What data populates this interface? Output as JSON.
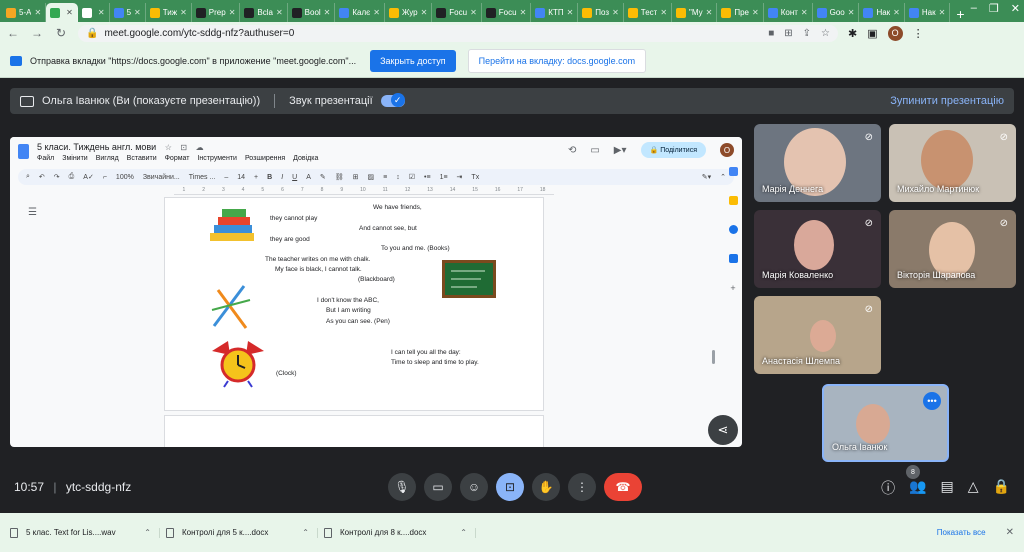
{
  "browser": {
    "tabs": [
      {
        "label": "5-A",
        "color": "#f5a623"
      },
      {
        "label": "",
        "color": "#34a853"
      },
      {
        "label": "",
        "color": "#ffffff"
      },
      {
        "label": "5",
        "color": "#4285f4"
      },
      {
        "label": "Тиж",
        "color": "#fbbc04"
      },
      {
        "label": "Prep",
        "color": "#202124"
      },
      {
        "label": "Вcla",
        "color": "#202124"
      },
      {
        "label": "Bool",
        "color": "#202124"
      },
      {
        "label": "Калє",
        "color": "#4285f4"
      },
      {
        "label": "Жур",
        "color": "#fbbc04"
      },
      {
        "label": "Focu",
        "color": "#202124"
      },
      {
        "label": "Focu",
        "color": "#202124"
      },
      {
        "label": "КТП",
        "color": "#4285f4"
      },
      {
        "label": "Поз",
        "color": "#fbbc04"
      },
      {
        "label": "Тест",
        "color": "#fbbc04"
      },
      {
        "label": "\"Му",
        "color": "#fbbc04"
      },
      {
        "label": "Пре",
        "color": "#fbbc04"
      },
      {
        "label": "Конт",
        "color": "#4285f4"
      },
      {
        "label": "Goo",
        "color": "#4285f4"
      },
      {
        "label": "Нак",
        "color": "#4285f4"
      },
      {
        "label": "Нак",
        "color": "#4285f4"
      }
    ],
    "url": "meet.google.com/ytc-sddg-nfz?authuser=0",
    "profile_initial": "О"
  },
  "sharebar": {
    "message": "Отправка вкладки \"https://docs.google.com\" в приложение \"meet.google.com\"...",
    "stop_label": "Закрыть доступ",
    "switch_label": "Перейти на вкладку: docs.google.com"
  },
  "presenting": {
    "text": "Ольга Іванюк (Ви (показуєте презентацію))",
    "audio_label": "Звук презентації",
    "stop_label": "Зупинити презентацію"
  },
  "doc": {
    "title": "5 класи. Тиждень англ. мови",
    "menu": [
      "Файл",
      "Змінити",
      "Вигляд",
      "Вставити",
      "Формат",
      "Інструменти",
      "Розширення",
      "Довідка"
    ],
    "share_label": "Поділитися",
    "avatar_initial": "О",
    "toolbar": {
      "zoom": "100%",
      "style": "Звичайни...",
      "font": "Times ...",
      "size": "14"
    },
    "ruler": [
      "1",
      "2",
      "3",
      "4",
      "5",
      "6",
      "7",
      "8",
      "9",
      "10",
      "11",
      "12",
      "13",
      "14",
      "15",
      "16",
      "17",
      "18"
    ],
    "lines": [
      {
        "text": "We have friends,"
      },
      {
        "text": "they cannot play"
      },
      {
        "text": "And cannot see, but"
      },
      {
        "text": "they are good"
      },
      {
        "text": "To you and me.        (Books)"
      },
      {
        "text": "The teacher writes on me with chalk."
      },
      {
        "text": "My face is black, I cannot talk."
      },
      {
        "text": "(Blackboard)"
      },
      {
        "text": "I don't know the ABC,"
      },
      {
        "text": "But I am writing"
      },
      {
        "text": "As you can see.       (Pen)"
      },
      {
        "text": "I can tell you all the day:"
      },
      {
        "text": "Time to sleep and time to play."
      },
      {
        "text": "(Clock)"
      }
    ]
  },
  "participants": [
    {
      "name": "Марія Деннега",
      "bg": "#6d7580",
      "face": "#e4c3b0"
    },
    {
      "name": "Михайло Мартинюк",
      "bg": "#c9c1b5",
      "face": "#c89270"
    },
    {
      "name": "Марія Коваленко",
      "bg": "#3a3038",
      "face": "#d9a89a"
    },
    {
      "name": "Вікторія Шарапова",
      "bg": "#8a7a6a",
      "face": "#e5c1a6"
    },
    {
      "name": "Анастасія Шлемпа",
      "bg": "#b7a58b",
      "face": "#dcaa95"
    },
    {
      "name": "Ольга Іванюк",
      "bg": "#a8b4c0",
      "face": "#d8a993"
    }
  ],
  "bottom": {
    "time": "10:57",
    "meeting_code": "ytc-sddg-nfz",
    "people_count": "8"
  },
  "downloads": {
    "items": [
      {
        "name": "5 клас. Text for Lis....wav"
      },
      {
        "name": "Контролі для 5 к....docx"
      },
      {
        "name": "Контролі для 8 к....docx"
      }
    ],
    "show_all": "Показать все"
  }
}
